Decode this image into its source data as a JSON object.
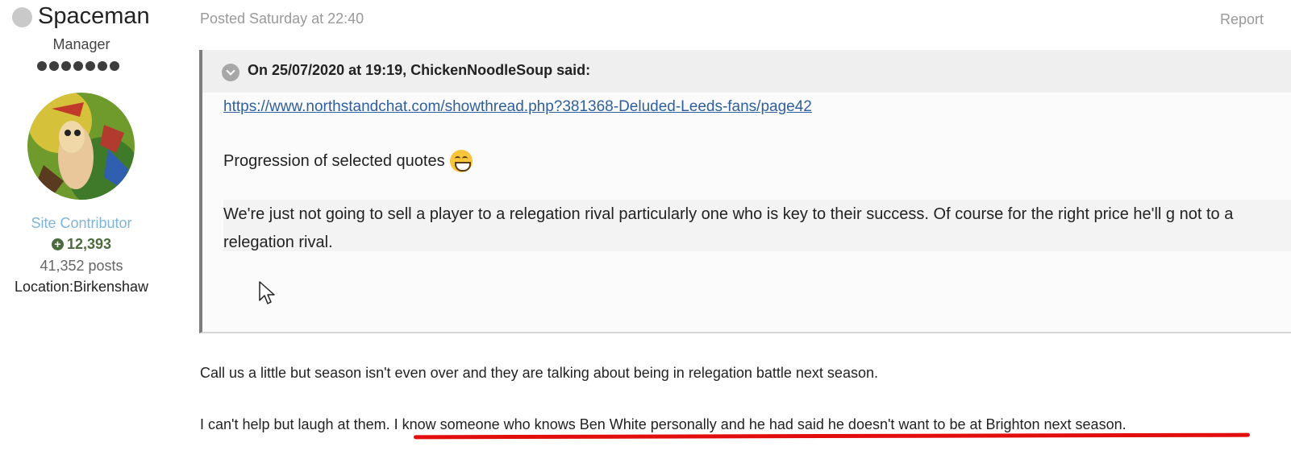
{
  "author": {
    "name": "Spaceman",
    "rank": "Manager",
    "rank_pips": 7,
    "group": "Site Contributor",
    "reputation": "12,393",
    "reputation_icon": "plus-circle-icon",
    "posts": "41,352 posts",
    "location": "Location:Birkenshaw",
    "status_color": "#c9c9c9"
  },
  "post": {
    "posted": "Posted Saturday at 22:40",
    "report_label": "Report",
    "quote": {
      "cite": "On 25/07/2020 at 19:19, ChickenNoodleSoup said:",
      "link": "https://www.northstandchat.com/showthread.php?381368-Deluded-Leeds-fans/page42",
      "line1": "Progression of selected quotes",
      "emoji": "grinning-face-icon",
      "nested": "We're just not going to sell a player to a relegation rival particularly one who is key to their success. Of course for the right price he'll g not to a relegation rival."
    },
    "body": {
      "para1": "Call us a little but season isn't even over and they are talking about being in relegation battle next season.",
      "para2": "I can't help but laugh at them. I know someone who knows Ben White personally and he had said he doesn't want to be at Brighton next season."
    }
  },
  "colors": {
    "link": "#2f5f9e",
    "contributor": "#7fb5d8",
    "reputation": "#4d6b3d",
    "highlight_underline": "#e20d0d"
  }
}
